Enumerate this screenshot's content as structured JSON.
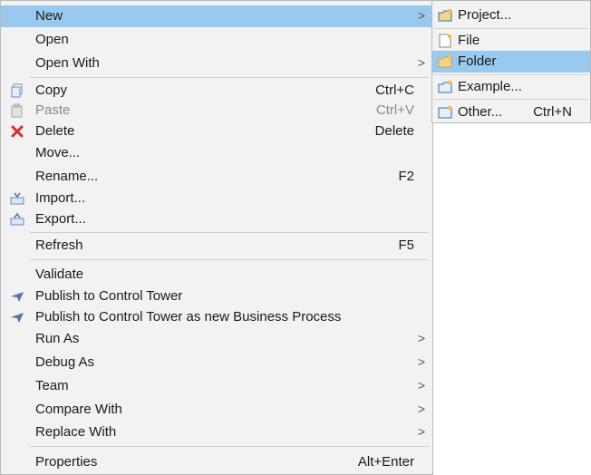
{
  "main_menu": {
    "new": "New",
    "open": "Open",
    "open_with": "Open With",
    "copy": "Copy",
    "copy_acc": "Ctrl+C",
    "paste": "Paste",
    "paste_acc": "Ctrl+V",
    "delete": "Delete",
    "delete_acc": "Delete",
    "move": "Move...",
    "rename": "Rename...",
    "rename_acc": "F2",
    "import": "Import...",
    "export": "Export...",
    "refresh": "Refresh",
    "refresh_acc": "F5",
    "validate": "Validate",
    "publish": "Publish to Control Tower",
    "publish_new": "Publish to Control Tower as new Business Process",
    "run_as": "Run As",
    "debug_as": "Debug As",
    "team": "Team",
    "compare_with": "Compare With",
    "replace_with": "Replace With",
    "properties": "Properties",
    "properties_acc": "Alt+Enter",
    "submenu_arrow": ">"
  },
  "sub_menu": {
    "project": "Project...",
    "file": "File",
    "folder": "Folder",
    "example": "Example...",
    "other": "Other...",
    "other_acc": "Ctrl+N"
  },
  "icons": {
    "copy": "copy-icon",
    "paste": "paste-icon",
    "delete": "delete-icon",
    "import": "import-icon",
    "export": "export-icon",
    "publish": "publish-icon",
    "project": "new-project-icon",
    "file": "new-file-icon",
    "folder": "new-folder-icon",
    "example": "example-icon",
    "other": "other-wizard-icon"
  },
  "colors": {
    "highlight": "#99c9ef",
    "menu_bg": "#f2f2f2",
    "delete_red": "#d92b2b",
    "publish_blue": "#5b6fa8"
  }
}
